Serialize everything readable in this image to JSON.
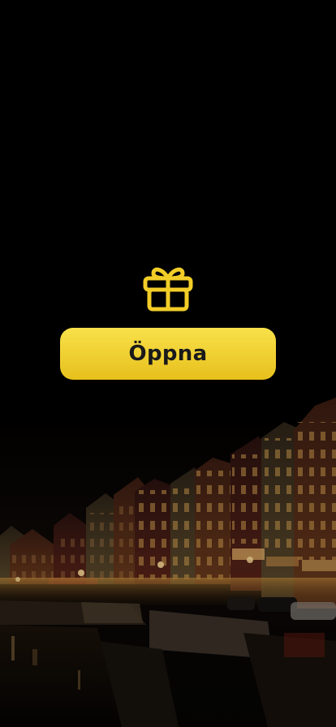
{
  "main": {
    "open_label": "Öppna"
  },
  "icons": {
    "gift": "gift-icon"
  },
  "colors": {
    "background": "#000000",
    "accent": "#f2cd28",
    "button_text": "#1a1a1a"
  }
}
